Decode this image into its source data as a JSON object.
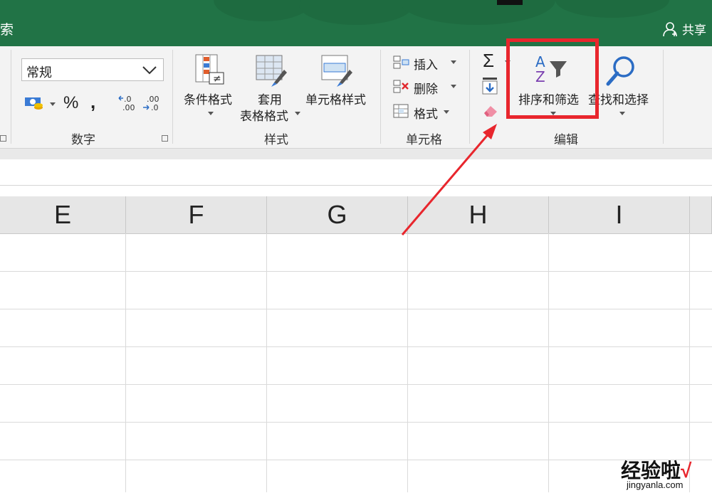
{
  "titlebar": {
    "search_fragment": "索",
    "share_label": "共享"
  },
  "colors": {
    "excel_green": "#217346",
    "highlight_red": "#e8262d"
  },
  "ribbon": {
    "number_group": {
      "format_select_value": "常规",
      "percent": "%",
      "comma": ",",
      "inc_decimal": ".0\n.00",
      "dec_decimal": ".00\n→.0",
      "label": "数字"
    },
    "styles_group": {
      "conditional_format": "条件格式",
      "format_as_table_line1": "套用",
      "format_as_table_line2": "表格格式",
      "cell_styles": "单元格样式",
      "label": "样式"
    },
    "cells_group": {
      "insert": "插入",
      "delete": "删除",
      "format": "格式",
      "label": "单元格"
    },
    "editing_group": {
      "autosum": "Σ",
      "sort_filter": "排序和筛选",
      "find_select": "查找和选择",
      "label": "编辑"
    }
  },
  "sheet": {
    "columns": [
      "E",
      "F",
      "G",
      "H",
      "I"
    ]
  },
  "watermark": {
    "main": "经验啦",
    "check": "√",
    "sub": "jingyanla.com"
  }
}
